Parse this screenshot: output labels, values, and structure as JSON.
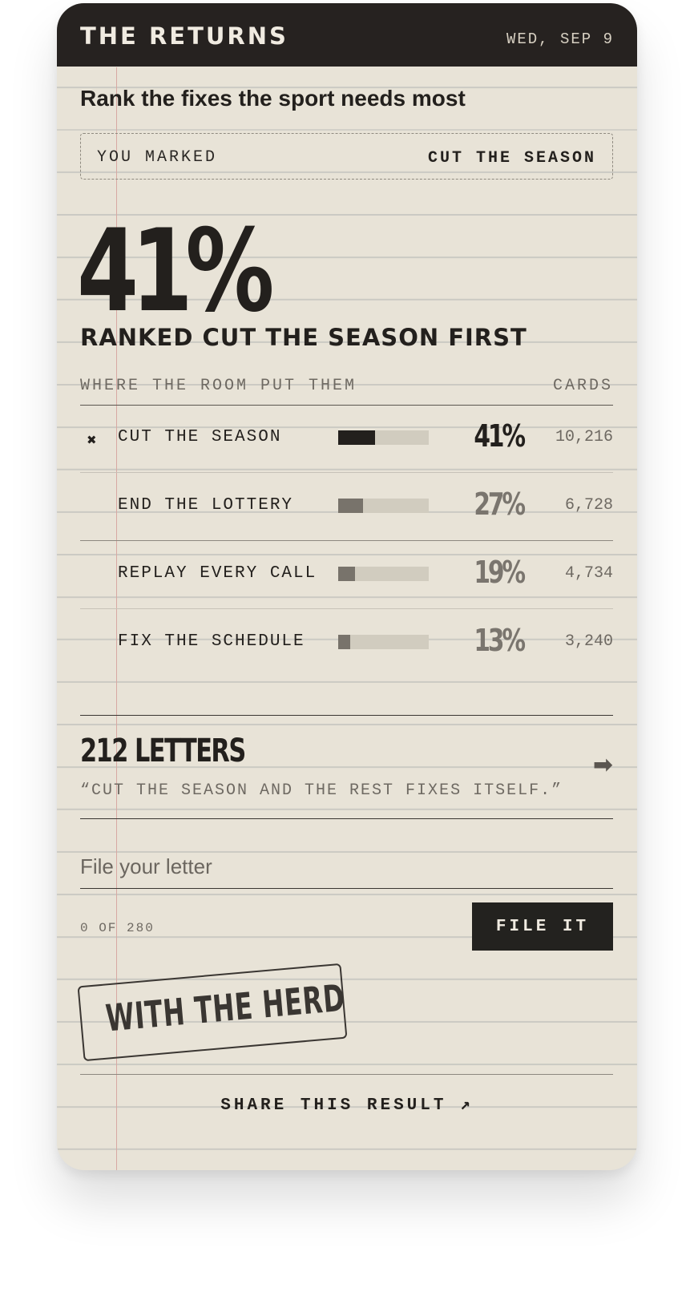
{
  "header": {
    "title": "THE RETURNS",
    "date": "WED, SEP 9"
  },
  "question": "Rank the fixes the sport needs most",
  "marked": {
    "label": "YOU MARKED",
    "value": "CUT THE SEASON"
  },
  "result": {
    "percent": "41%",
    "caption": "RANKED CUT THE SEASON FIRST"
  },
  "table": {
    "heading": "WHERE THE ROOM PUT THEM",
    "count_heading": "CARDS",
    "rows": [
      {
        "mark": "✖",
        "label": "CUT THE SEASON",
        "share": 0.41,
        "pct": "41%",
        "count": "10,216",
        "selected": true
      },
      {
        "mark": "",
        "label": "END THE LOTTERY",
        "share": 0.27,
        "pct": "27%",
        "count": "6,728",
        "selected": false
      },
      {
        "mark": "",
        "label": "REPLAY EVERY CALL",
        "share": 0.19,
        "pct": "19%",
        "count": "4,734",
        "selected": false
      },
      {
        "mark": "",
        "label": "FIX THE SCHEDULE",
        "share": 0.13,
        "pct": "13%",
        "count": "3,240",
        "selected": false
      }
    ]
  },
  "letters": {
    "count": "212 LETTERS",
    "quote": "“CUT THE SEASON AND THE REST FIXES ITSELF.”…",
    "arrow": "➡"
  },
  "compose": {
    "placeholder": "File your letter",
    "counter": "0 OF 280",
    "button": "FILE IT"
  },
  "stamp": "WITH THE HERD",
  "share": "SHARE THIS RESULT ↗",
  "colors": {
    "ink": "#23201d",
    "paper": "#e8e3d7",
    "bar_muted": "#78736b",
    "margin_rule": "#d8a9a3"
  }
}
